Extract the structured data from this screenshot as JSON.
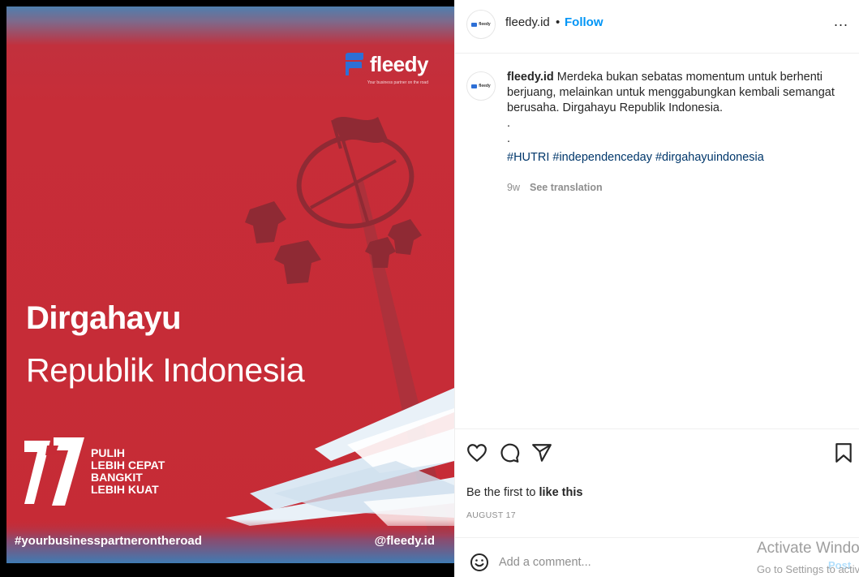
{
  "post_image": {
    "brand_name": "fleedy",
    "brand_tagline": "Your business partner on the road",
    "headline_bold": "Dirgahayu",
    "headline_light": "Republik Indonesia",
    "anniversary_number": "77",
    "slogan": [
      "PULIH",
      "LEBIH CEPAT",
      "BANGKIT",
      "LEBIH KUAT"
    ],
    "footer_hashtag": "#yourbusinesspartnerontheroad",
    "footer_handle": "@fleedy.id",
    "colors": {
      "background_red": "#c62b36",
      "white": "#ffffff",
      "accent_blue": "#2d6fd6"
    }
  },
  "header": {
    "avatar_text": "fleedy",
    "username": "fleedy.id",
    "separator": "•",
    "follow_label": "Follow",
    "more_label": "..."
  },
  "caption": {
    "avatar_text": "fleedy",
    "username": "fleedy.id",
    "text": "Merdeka bukan sebatas momentum untuk berhenti berjuang, melainkan untuk menggabungkan kembali semangat berusaha. Dirgahayu Republik Indonesia.",
    "dot_lines": [
      ".",
      "."
    ],
    "hashtags": "#HUTRI #independenceday #dirgahayuindonesia",
    "time_ago": "9w",
    "see_translation": "See translation"
  },
  "actions": {
    "icons": [
      "heart-icon",
      "comment-icon",
      "share-icon",
      "bookmark-icon"
    ],
    "likes_prefix": "Be the first to ",
    "likes_bold": "like this",
    "date": "AUGUST 17"
  },
  "comment_bar": {
    "placeholder": "Add a comment...",
    "post_label": "Post"
  },
  "watermark": {
    "title": "Activate Windows",
    "subtitle": "Go to Settings to activate Windows."
  },
  "colors": {
    "follow_blue": "#0095f6",
    "hashtag_blue": "#00376b",
    "muted_gray": "#8e8e8e",
    "post_disabled": "#b2dffc"
  }
}
